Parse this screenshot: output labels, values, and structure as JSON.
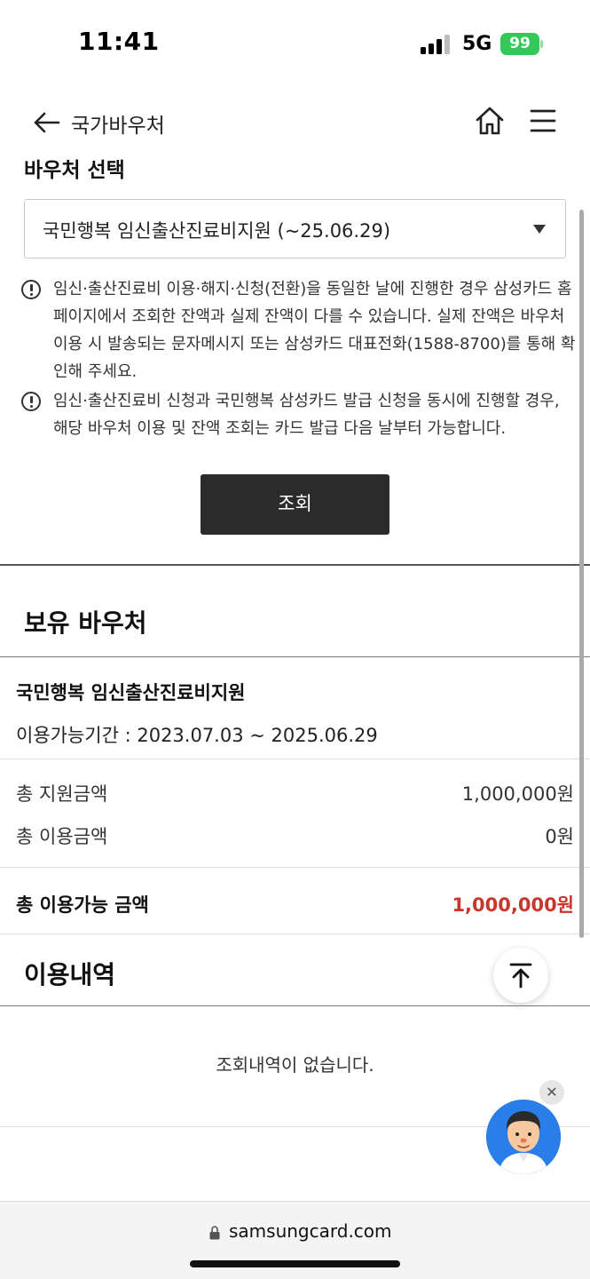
{
  "status_bar": {
    "time": "11:41",
    "network": "5G",
    "battery": "99"
  },
  "header": {
    "title": "국가바우처"
  },
  "voucher_select": {
    "label": "바우처 선택",
    "selected": "국민행복 임신출산진료비지원 (~25.06.29)"
  },
  "notices": [
    "임신·출산진료비 이용·해지·신청(전환)을 동일한 날에 진행한 경우 삼성카드 홈페이지에서 조회한 잔액과 실제 잔액이 다를 수 있습니다. 실제 잔액은 바우처 이용 시 발송되는 문자메시지 또는 삼성카드 대표전화(1588-8700)를 통해 확인해 주세요.",
    "임신·출산진료비 신청과 국민행복 삼성카드 발급 신청을 동시에 진행할 경우, 해당 바우처 이용 및 잔액 조회는 카드 발급 다음 날부터 가능합니다."
  ],
  "inquiry_button": "조회",
  "owned_section": {
    "title": "보유 바우처",
    "voucher_name": "국민행복 임신출산진료비지원",
    "period": "이용가능기간 : 2023.07.03 ~ 2025.06.29",
    "rows": [
      {
        "label": "총 지원금액",
        "value": "1,000,000원"
      },
      {
        "label": "총 이용금액",
        "value": "0원"
      }
    ],
    "available": {
      "label": "총 이용가능 금액",
      "value": "1,000,000원"
    }
  },
  "usage_section": {
    "title": "이용내역",
    "empty_message": "조회내역이 없습니다."
  },
  "url_bar": {
    "domain": "samsungcard.com"
  },
  "colors": {
    "accent_red": "#c8372d",
    "button_dark": "#2b2b2b",
    "battery_green": "#34c759"
  }
}
